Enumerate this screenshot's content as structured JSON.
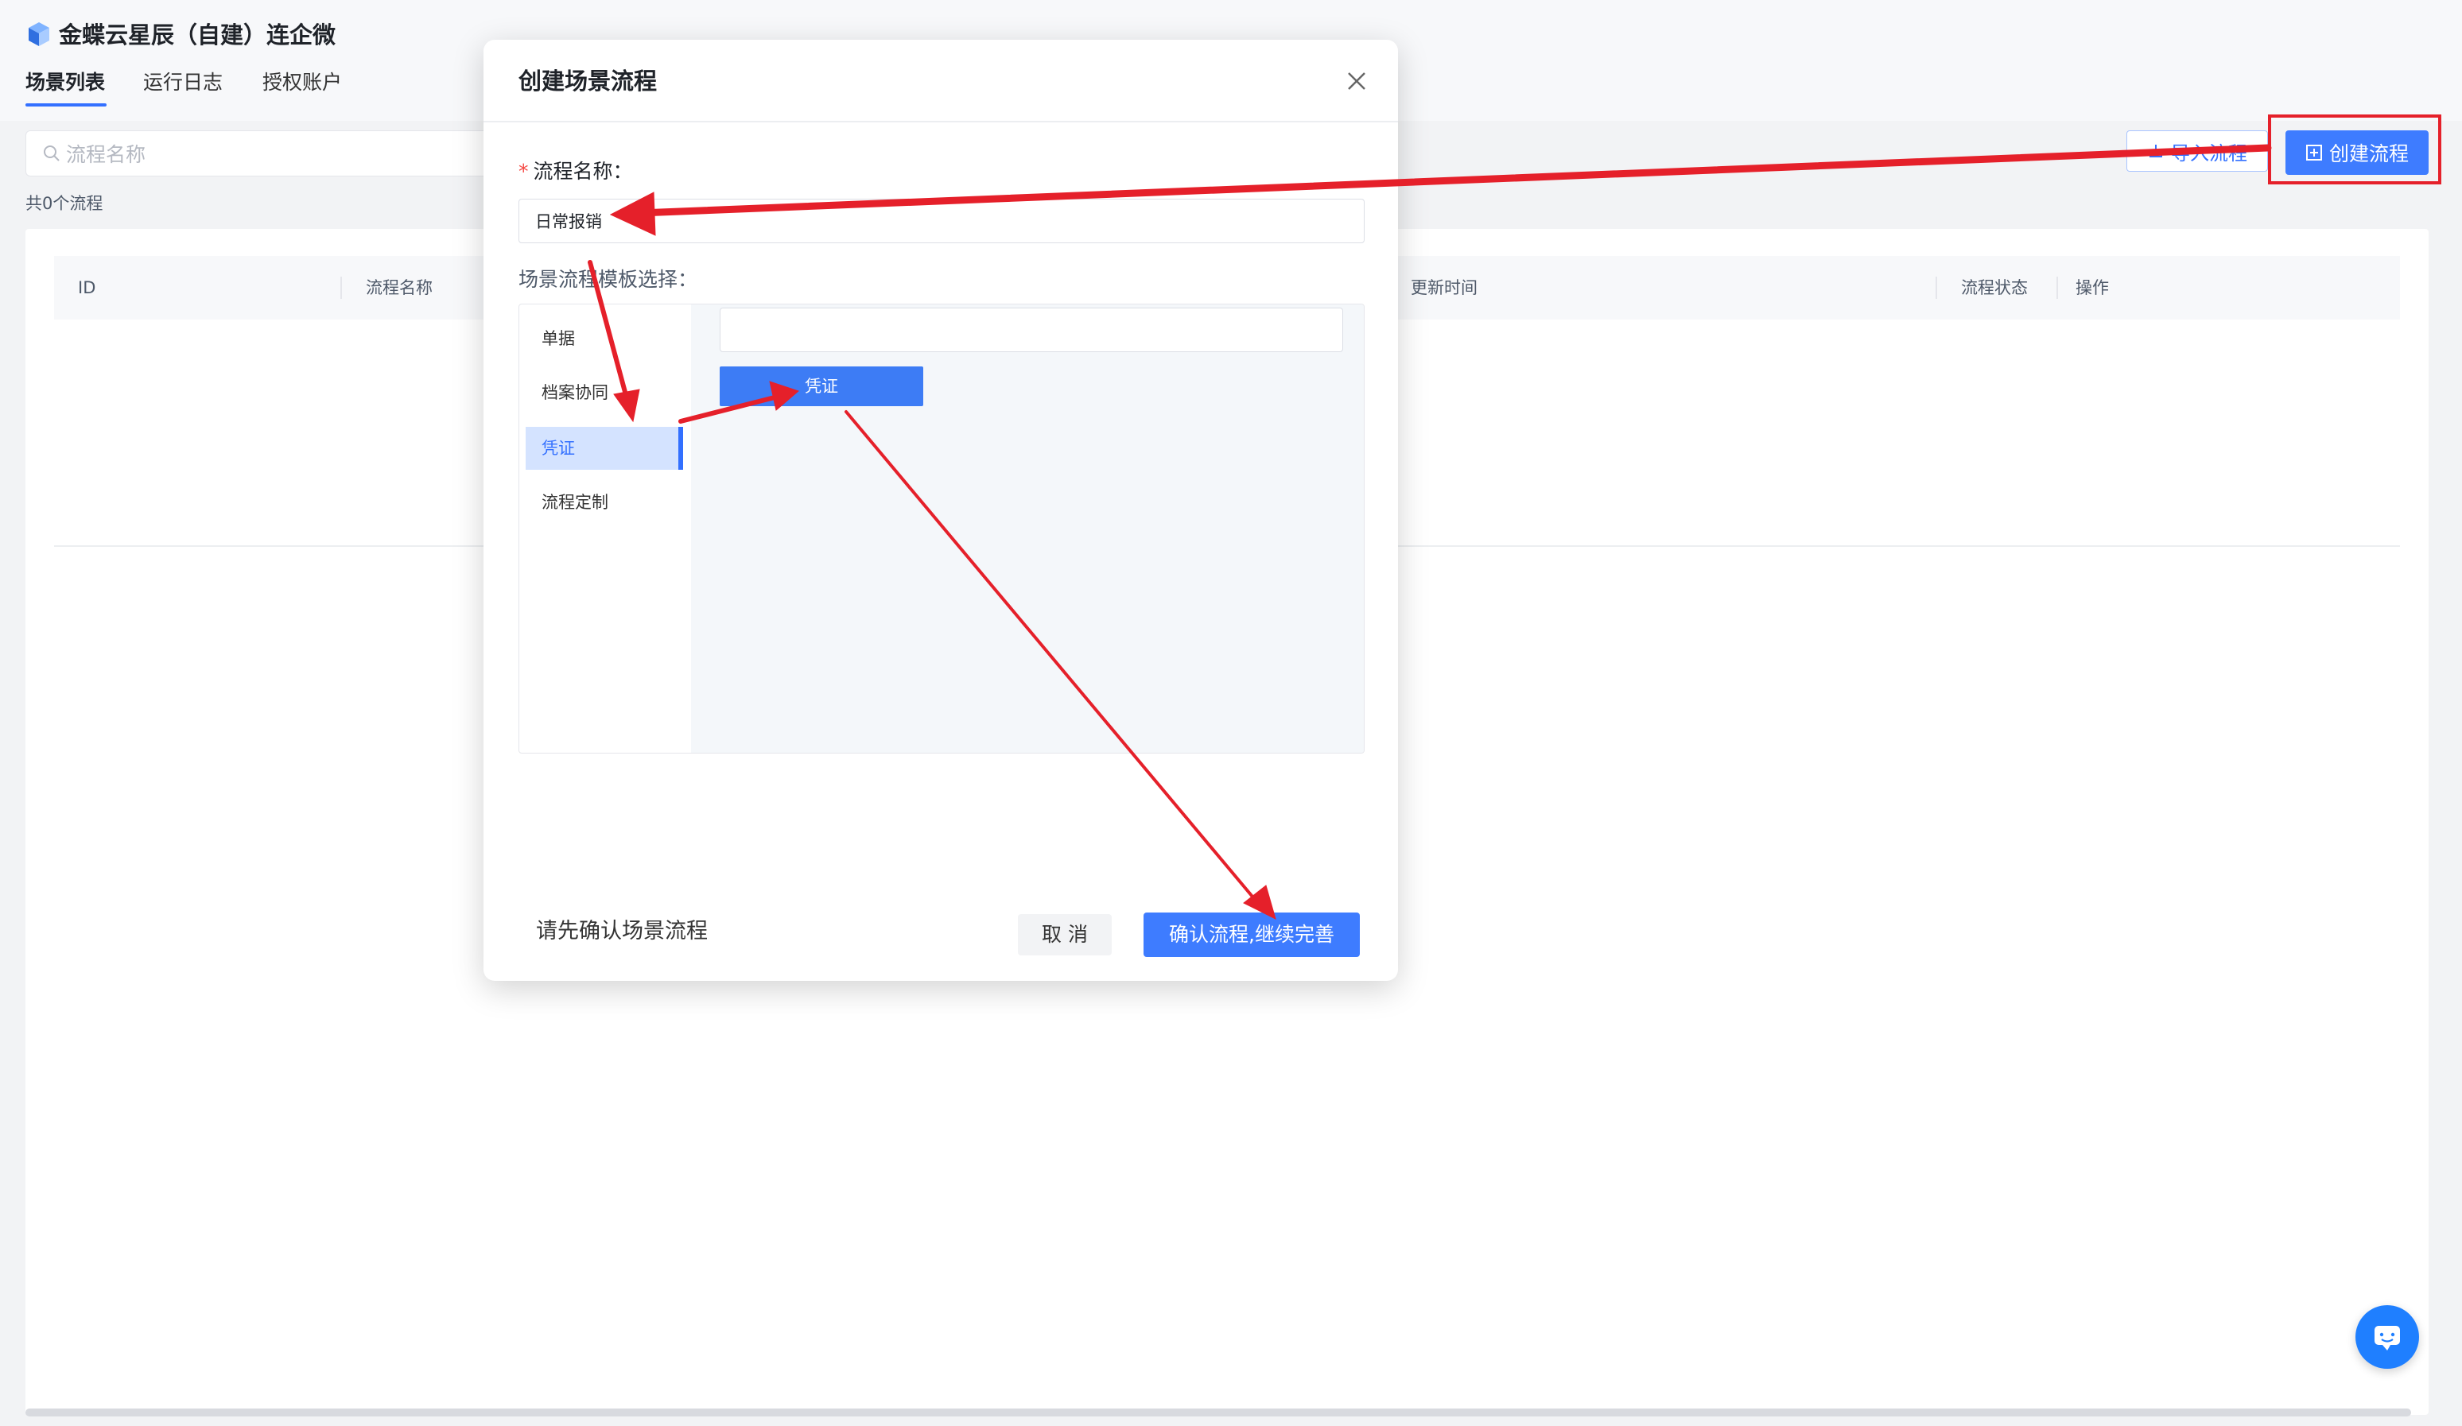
{
  "app": {
    "title": "金蝶云星辰（自建）连企微",
    "tabs": [
      {
        "label": "场景列表",
        "active": true
      },
      {
        "label": "运行日志",
        "active": false
      },
      {
        "label": "授权账户",
        "active": false
      }
    ]
  },
  "toolbar": {
    "search_placeholder": "流程名称",
    "count_text": "共0个流程",
    "import_label": "导入流程",
    "create_label": "创建流程"
  },
  "table": {
    "columns": [
      "ID",
      "流程名称",
      "更新时间",
      "流程状态",
      "操作"
    ],
    "rows": []
  },
  "modal": {
    "title": "创建场景流程",
    "name_label": "流程名称：",
    "name_value": "日常报销",
    "template_label": "场景流程模板选择：",
    "categories": [
      {
        "label": "单据",
        "active": false
      },
      {
        "label": "档案协同",
        "active": false
      },
      {
        "label": "凭证",
        "active": true
      },
      {
        "label": "流程定制",
        "active": false
      }
    ],
    "template_search_value": "",
    "template_cards": [
      "凭证"
    ],
    "footer_hint": "请先确认场景流程",
    "cancel_label": "取 消",
    "confirm_label": "确认流程,继续完善"
  },
  "colors": {
    "primary": "#3e7cff",
    "annotation": "#e5202a",
    "selected_bg": "#d4e3ff"
  },
  "icons": [
    "app-logo-icon",
    "search-icon",
    "import-icon",
    "plus-square-icon",
    "close-icon",
    "chat-icon"
  ]
}
